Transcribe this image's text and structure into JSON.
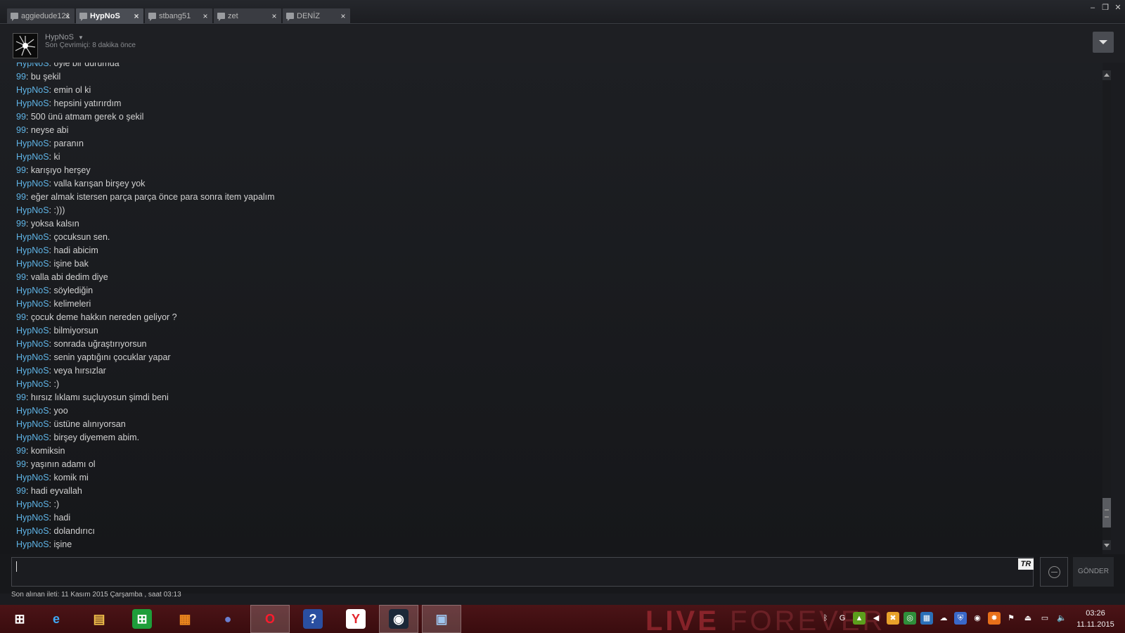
{
  "tabs": [
    {
      "label": "aggiedude121",
      "active": false
    },
    {
      "label": "HypNoS",
      "active": true
    },
    {
      "label": "stbang51",
      "active": false
    },
    {
      "label": "zet",
      "active": false
    },
    {
      "label": "DENİZ",
      "active": false
    }
  ],
  "tab_close_glyph": "×",
  "window_controls": {
    "minimize": "–",
    "restore": "❐",
    "close": "✕"
  },
  "header": {
    "friend_name": "HypNoS",
    "status": "Son Çevrimiçi: 8 dakika önce"
  },
  "messages": [
    {
      "sender": "HypNoS",
      "text": "öyle bir durumda"
    },
    {
      "sender": "99",
      "text": "bu şekil"
    },
    {
      "sender": "HypNoS",
      "text": "emin ol ki"
    },
    {
      "sender": "HypNoS",
      "text": "hepsini yatırırdım"
    },
    {
      "sender": "99",
      "text": "500 ünü atmam gerek o şekil"
    },
    {
      "sender": "99",
      "text": "neyse abi"
    },
    {
      "sender": "HypNoS",
      "text": "paranın"
    },
    {
      "sender": "HypNoS",
      "text": "ki"
    },
    {
      "sender": "99",
      "text": "karışıyo herşey"
    },
    {
      "sender": "HypNoS",
      "text": "valla karışan birşey yok"
    },
    {
      "sender": "99",
      "text": "eğer almak istersen parça parça önce para sonra item yapalım"
    },
    {
      "sender": "HypNoS",
      "text": ":)))"
    },
    {
      "sender": "99",
      "text": "yoksa kalsın"
    },
    {
      "sender": "HypNoS",
      "text": "çocuksun sen."
    },
    {
      "sender": "HypNoS",
      "text": "hadi abicim"
    },
    {
      "sender": "HypNoS",
      "text": "işine bak"
    },
    {
      "sender": "99",
      "text": "valla abi dedim diye"
    },
    {
      "sender": "HypNoS",
      "text": "söylediğin"
    },
    {
      "sender": "HypNoS",
      "text": "kelimeleri"
    },
    {
      "sender": "99",
      "text": "çocuk deme hakkın nereden geliyor ?"
    },
    {
      "sender": "HypNoS",
      "text": "bilmiyorsun"
    },
    {
      "sender": "HypNoS",
      "text": "sonrada uğraştırıyorsun"
    },
    {
      "sender": "HypNoS",
      "text": "senin yaptığını çocuklar yapar"
    },
    {
      "sender": "HypNoS",
      "text": "veya hırsızlar"
    },
    {
      "sender": "HypNoS",
      "text": ":)"
    },
    {
      "sender": "99",
      "text": "hırsız lıklamı suçluyosun şimdi beni"
    },
    {
      "sender": "HypNoS",
      "text": "yoo"
    },
    {
      "sender": "HypNoS",
      "text": "üstüne alınıyorsan"
    },
    {
      "sender": "HypNoS",
      "text": "birşey diyemem abim."
    },
    {
      "sender": "99",
      "text": "komiksin"
    },
    {
      "sender": "99",
      "text": "yaşının adamı ol"
    },
    {
      "sender": "HypNoS",
      "text": "komik mi"
    },
    {
      "sender": "99",
      "text": "hadi eyvallah"
    },
    {
      "sender": "HypNoS",
      "text": ":)"
    },
    {
      "sender": "HypNoS",
      "text": "hadi"
    },
    {
      "sender": "HypNoS",
      "text": "dolandırıcı"
    },
    {
      "sender": "HypNoS",
      "text": "işine"
    }
  ],
  "sender_separator": ": ",
  "input": {
    "value": "",
    "language_badge": "TR"
  },
  "send_button_label": "GÖNDER",
  "last_message_info": "Son alınan ileti: 11 Kasım 2015 Çarşamba , saat 03:13",
  "taskbar": {
    "wallpaper_text_bold": "LIVE",
    "wallpaper_text_light": " FOREVER",
    "apps": [
      {
        "name": "start-button",
        "glyph": "⊞",
        "color": "#ffffff",
        "bg": "transparent",
        "active": false
      },
      {
        "name": "internet-explorer-app",
        "glyph": "e",
        "color": "#3fa9f5",
        "bg": "transparent",
        "active": false
      },
      {
        "name": "file-explorer-app",
        "glyph": "▤",
        "color": "#f3c34b",
        "bg": "transparent",
        "active": false
      },
      {
        "name": "windows-store-app",
        "glyph": "⊞",
        "color": "#ffffff",
        "bg": "#1e9e3a",
        "active": false
      },
      {
        "name": "office-app",
        "glyph": "▦",
        "color": "#f28b1e",
        "bg": "transparent",
        "active": false
      },
      {
        "name": "globe-app",
        "glyph": "●",
        "color": "#6a7fd0",
        "bg": "transparent",
        "active": false
      },
      {
        "name": "opera-app",
        "glyph": "O",
        "color": "#ff1b2d",
        "bg": "transparent",
        "active": true
      },
      {
        "name": "help-app",
        "glyph": "?",
        "color": "#ffffff",
        "bg": "#2a4fa0",
        "active": false
      },
      {
        "name": "yandex-app",
        "glyph": "Y",
        "color": "#e3262e",
        "bg": "#ffffff",
        "active": false
      },
      {
        "name": "steam-app",
        "glyph": "◉",
        "color": "#ffffff",
        "bg": "#1b2838",
        "active": true
      },
      {
        "name": "photo-viewer-app",
        "glyph": "▣",
        "color": "#9fc6ef",
        "bg": "transparent",
        "active": true
      }
    ],
    "tray_icons": [
      {
        "name": "bluetooth-icon",
        "glyph": "ᛒ",
        "bg": "transparent"
      },
      {
        "name": "g-hub-icon",
        "glyph": "G",
        "bg": "transparent"
      },
      {
        "name": "nvidia-icon",
        "glyph": "▲",
        "bg": "#5c9e1c"
      },
      {
        "name": "speaker-muted-icon",
        "glyph": "◀",
        "bg": "transparent"
      },
      {
        "name": "antivirus-icon",
        "glyph": "✖",
        "bg": "#e8a12a"
      },
      {
        "name": "chrome-icon",
        "glyph": "◎",
        "bg": "#2f8f3a"
      },
      {
        "name": "network-app-icon",
        "glyph": "▦",
        "bg": "#2a6fb8"
      },
      {
        "name": "cloud-icon",
        "glyph": "☁",
        "bg": "transparent"
      },
      {
        "name": "shield-icon",
        "glyph": "⛨",
        "bg": "#3a68c9"
      },
      {
        "name": "steam-tray-icon",
        "glyph": "◉",
        "bg": "transparent"
      },
      {
        "name": "avast-icon",
        "glyph": "✹",
        "bg": "#e8701a"
      },
      {
        "name": "flag-icon",
        "glyph": "⚑",
        "bg": "transparent"
      },
      {
        "name": "usb-icon",
        "glyph": "⏏",
        "bg": "transparent"
      },
      {
        "name": "network-icon",
        "glyph": "▭",
        "bg": "transparent"
      },
      {
        "name": "volume-icon",
        "glyph": "🔈",
        "bg": "transparent"
      }
    ],
    "clock_time": "03:26",
    "clock_date": "11.11.2015"
  }
}
